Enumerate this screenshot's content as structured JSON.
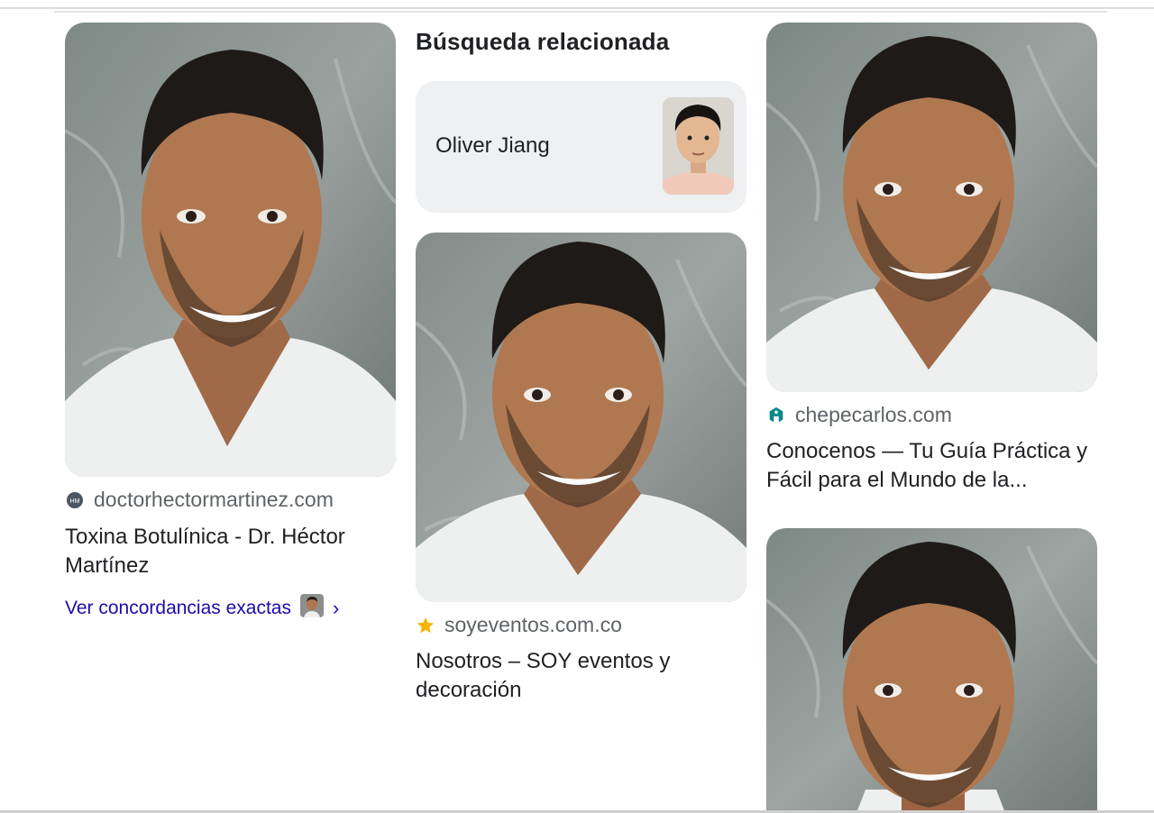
{
  "results": [
    {
      "site": "doctorhectormartinez.com",
      "title": "Toxina Botulínica - Dr. Héctor Martínez",
      "favicon": "hm-logo-icon",
      "exact_matches": "Ver concordancias exactas"
    },
    {
      "site": "soyeventos.com.co",
      "title": "Nosotros – SOY eventos y decoración",
      "favicon": "star-icon"
    },
    {
      "site": "chepecarlos.com",
      "title": "Conocenos — Tu Guía Práctica y Fácil para el Mundo de la...",
      "favicon": "teal-logo-icon"
    }
  ],
  "related": {
    "heading": "Búsqueda relacionada",
    "name": "Oliver Jiang"
  },
  "colors": {
    "link": "#1a0dab",
    "site_text": "#5f6368",
    "card_bg": "#eef0f2",
    "star": "#f4b400",
    "teal": "#0b8a8a"
  }
}
